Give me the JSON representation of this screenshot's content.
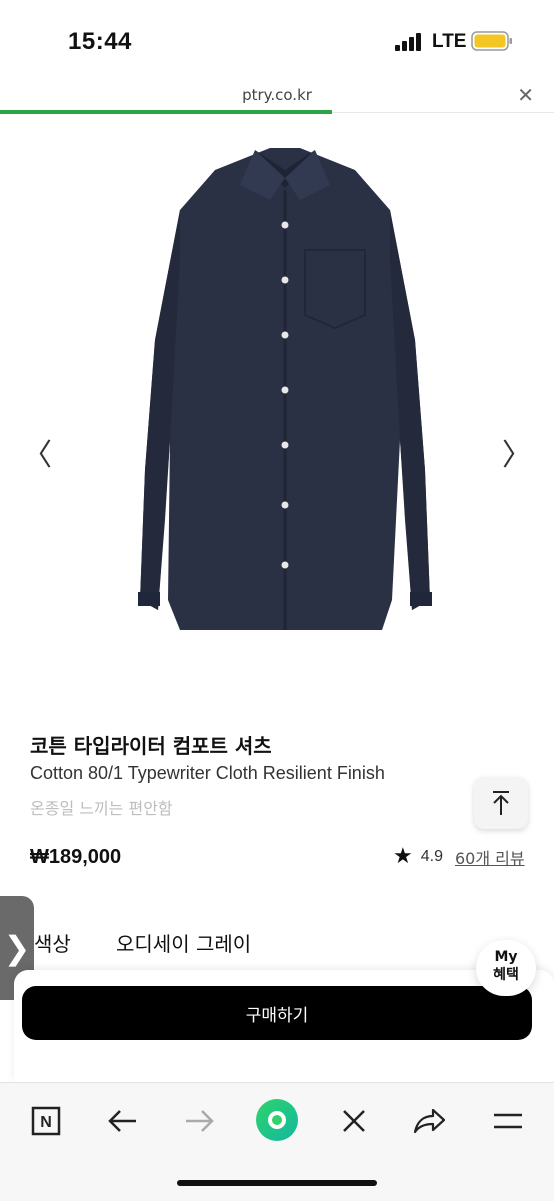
{
  "status": {
    "time": "15:44",
    "network": "LTE"
  },
  "browser": {
    "url": "ptry.co.kr",
    "load_progress": 0.6
  },
  "product": {
    "title": "코튼 타입라이터 컴포트 셔츠",
    "subtitle": "Cotton 80/1 Typewriter Cloth Resilient Finish",
    "tagline": "온종일 느끼는 편안함",
    "price": "₩189,000",
    "rating": "4.9",
    "reviews": "60개 리뷰"
  },
  "option": {
    "label": "색상",
    "value": "오디세이 그레이"
  },
  "side_tab": {
    "glyph": "❯"
  },
  "my_benefit": {
    "line1": "My",
    "line2": "혜택"
  },
  "buy_button": {
    "label": "구매하기"
  },
  "toolbar": {
    "icons": [
      "naver-n-icon",
      "back-arrow-icon",
      "forward-arrow-icon",
      "green-circle-icon",
      "close-icon",
      "share-icon",
      "menu-icon"
    ],
    "n_label": "N"
  },
  "colors": {
    "accent_green": "#2aa745",
    "shirt_navy": "#2a3145",
    "buy_button": "#000000"
  }
}
